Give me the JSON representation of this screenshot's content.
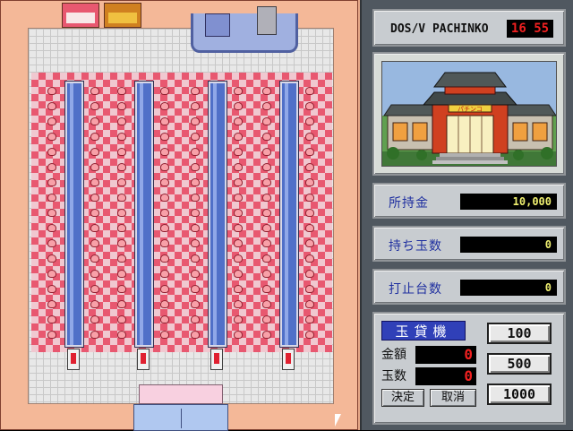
{
  "header": {
    "title": "DOS/V PACHINKO",
    "clock": "16 55"
  },
  "picture": {
    "sign_text": "パチンコ"
  },
  "stats": [
    {
      "label": "所持金",
      "value": "10,000"
    },
    {
      "label": "持ち玉数",
      "value": "0"
    },
    {
      "label": "打止台数",
      "value": "0"
    }
  ],
  "exchanger": {
    "title": "玉貸機",
    "amount_label": "金額",
    "amount_value": "0",
    "balls_label": "玉数",
    "balls_value": "0",
    "confirm_label": "決定",
    "cancel_label": "取消",
    "coin_buttons": [
      "100",
      "500",
      "1000"
    ]
  },
  "colors": {
    "carpet_check": "#e85870",
    "machine_row": "#5070c8",
    "panel_bg": "#505860",
    "display_text": "#f0f070",
    "display_red": "#f02020"
  },
  "icons": {
    "cursor": "arrow-cursor-icon"
  }
}
